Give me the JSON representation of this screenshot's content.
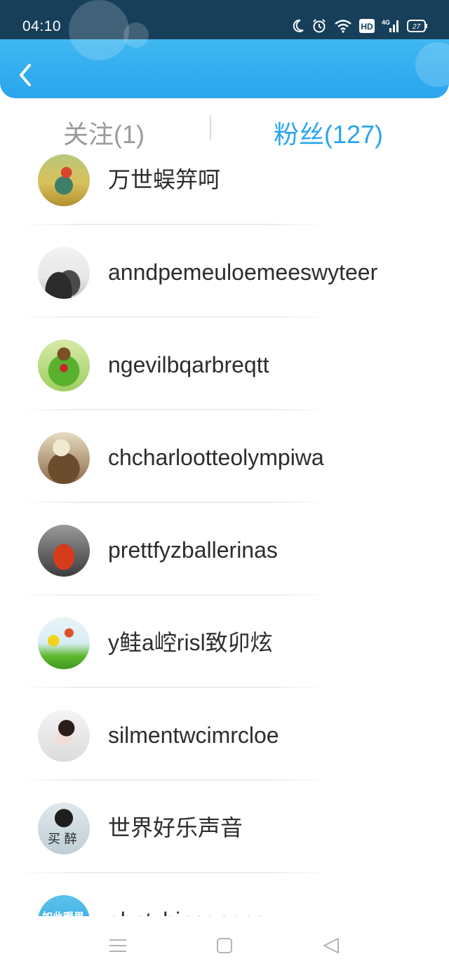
{
  "status_bar": {
    "time": "04:10",
    "icons": [
      "moon-icon",
      "alarm-icon",
      "wifi-icon",
      "hd-icon",
      "signal-4g-icon",
      "battery-icon"
    ],
    "network": "4G",
    "hd": "HD",
    "battery": "27"
  },
  "header": {
    "back_icon": "chevron-left-icon",
    "color_top": "#1b5f84",
    "color_bottom": "#2aa5ef"
  },
  "tabs": {
    "follow_label": "关注(1)",
    "fans_label": "粉丝(127)",
    "active": "fans",
    "active_color": "#2aa5ef"
  },
  "fans": [
    {
      "name": "万世蜈笄呵",
      "avatar": "avatar-girl-field"
    },
    {
      "name": "anndpemeuloemeeswyteer",
      "avatar": "avatar-mountain"
    },
    {
      "name": "ngevilbqarbreqtt",
      "avatar": "avatar-green-monster"
    },
    {
      "name": "chcharlootteolympiwa",
      "avatar": "avatar-anime"
    },
    {
      "name": "prettfyzballerinas",
      "avatar": "avatar-red-car"
    },
    {
      "name": "y鲑a崆risl致卯炫",
      "avatar": "avatar-flowers"
    },
    {
      "name": "silmentwcimrcloe",
      "avatar": "avatar-girl-sleeping"
    },
    {
      "name": "世界好乐声音",
      "avatar": "avatar-sunglasses",
      "avatar_text": "买 醉"
    },
    {
      "name": "abatxbinogacne",
      "avatar": "avatar-blue-text",
      "avatar_text": "如此暖男"
    }
  ],
  "nav_bar": {
    "icons": [
      "menu-icon",
      "home-square-icon",
      "back-triangle-icon"
    ]
  }
}
